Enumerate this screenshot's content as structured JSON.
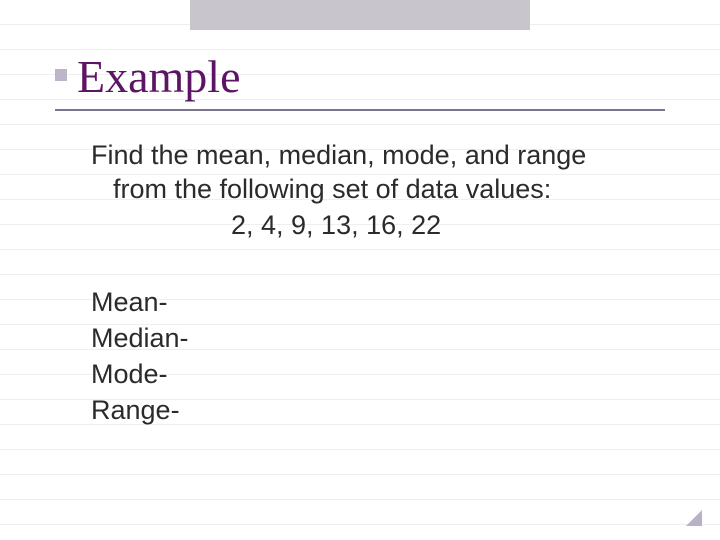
{
  "title": "Example",
  "prompt": {
    "line1": "Find the mean, median, mode, and range",
    "line2": "from the following set of data values:",
    "data_values": "2, 4, 9, 13, 16, 22"
  },
  "answers": {
    "mean": "Mean-",
    "median": "Median-",
    "mode": "Mode-",
    "range": "Range-"
  }
}
